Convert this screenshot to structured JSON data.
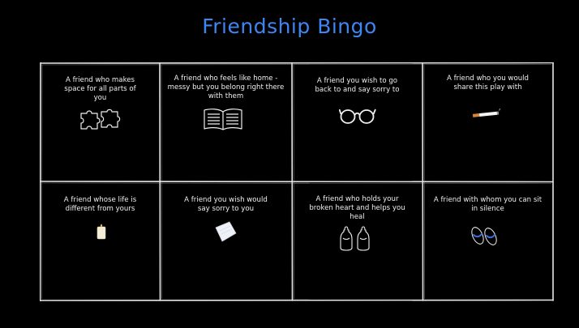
{
  "title": "Friendship Bingo",
  "cells": [
    {
      "text": "A friend who makes space for all parts of you",
      "icon": "puzzle-pieces-icon"
    },
    {
      "text": "A friend who feels like home - messy but you belong right there with them",
      "icon": "open-book-icon"
    },
    {
      "text": "A friend you wish to go back to and say sorry to",
      "icon": "glasses-icon"
    },
    {
      "text": "A friend who you would share this play with",
      "icon": "cigarette-icon"
    },
    {
      "text": "A friend whose life is different from yours",
      "icon": "candle-icon"
    },
    {
      "text": "A friend you wish would say sorry to you",
      "icon": "paper-sheet-icon"
    },
    {
      "text": "A friend who holds your broken heart and helps you heal",
      "icon": "baby-bottles-icon"
    },
    {
      "text": "A friend with whom you can sit in silence",
      "icon": "flip-flops-icon"
    }
  ],
  "colors": {
    "background": "#000000",
    "title": "#3f86f2",
    "chalk": "#e8e8e8",
    "flipflop_strap": "#3a6fd8"
  }
}
